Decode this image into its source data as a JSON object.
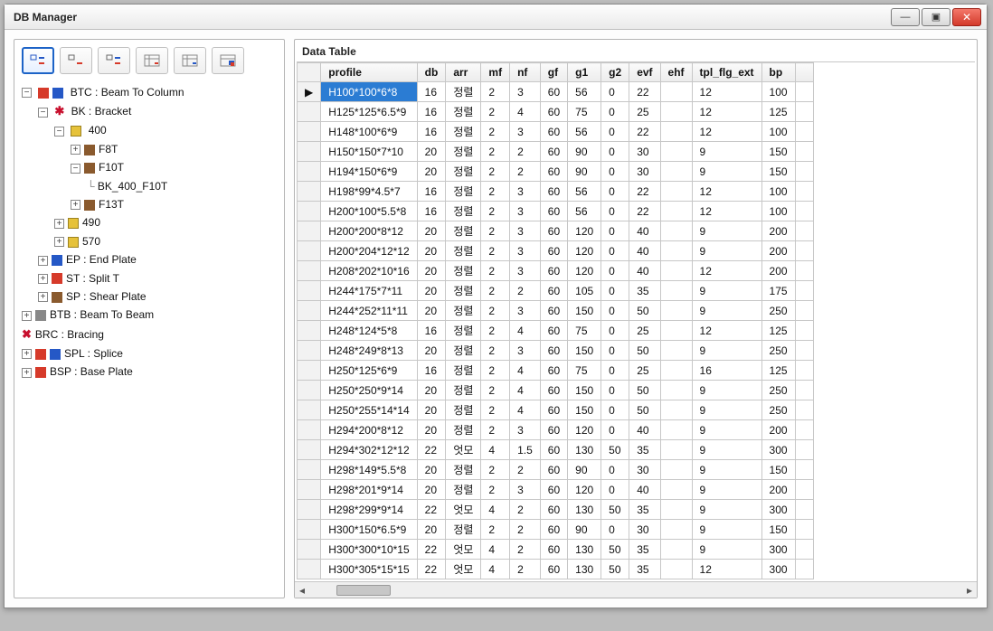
{
  "window": {
    "title": "DB Manager"
  },
  "panel": {
    "data_table_title": "Data Table"
  },
  "tree": {
    "btc": {
      "label": "BTC : Beam To Column"
    },
    "bk": {
      "label": "BK : Bracket"
    },
    "n400": {
      "label": "400"
    },
    "f8t": {
      "label": "F8T"
    },
    "f10t": {
      "label": "F10T"
    },
    "bk400f10t": {
      "label": "BK_400_F10T"
    },
    "f13t": {
      "label": "F13T"
    },
    "n490": {
      "label": "490"
    },
    "n570": {
      "label": "570"
    },
    "ep": {
      "label": "EP : End Plate"
    },
    "st": {
      "label": "ST : Split T"
    },
    "sp": {
      "label": "SP : Shear Plate"
    },
    "btb": {
      "label": "BTB : Beam To Beam"
    },
    "brc": {
      "label": "BRC : Bracing"
    },
    "spl": {
      "label": "SPL : Splice"
    },
    "bsp": {
      "label": "BSP : Base Plate"
    }
  },
  "columns": [
    "profile",
    "db",
    "arr",
    "mf",
    "nf",
    "gf",
    "g1",
    "g2",
    "evf",
    "ehf",
    "tpl_flg_ext",
    "bp"
  ],
  "rows": [
    {
      "profile": "H100*100*6*8",
      "db": "16",
      "arr": "정렬",
      "mf": "2",
      "nf": "3",
      "gf": "60",
      "g1": "56",
      "g2": "0",
      "evf": "22",
      "ehf": "",
      "tpl_flg_ext": "12",
      "bp": "100"
    },
    {
      "profile": "H125*125*6.5*9",
      "db": "16",
      "arr": "정렬",
      "mf": "2",
      "nf": "4",
      "gf": "60",
      "g1": "75",
      "g2": "0",
      "evf": "25",
      "ehf": "",
      "tpl_flg_ext": "12",
      "bp": "125"
    },
    {
      "profile": "H148*100*6*9",
      "db": "16",
      "arr": "정렬",
      "mf": "2",
      "nf": "3",
      "gf": "60",
      "g1": "56",
      "g2": "0",
      "evf": "22",
      "ehf": "",
      "tpl_flg_ext": "12",
      "bp": "100"
    },
    {
      "profile": "H150*150*7*10",
      "db": "20",
      "arr": "정렬",
      "mf": "2",
      "nf": "2",
      "gf": "60",
      "g1": "90",
      "g2": "0",
      "evf": "30",
      "ehf": "",
      "tpl_flg_ext": "9",
      "bp": "150"
    },
    {
      "profile": "H194*150*6*9",
      "db": "20",
      "arr": "정렬",
      "mf": "2",
      "nf": "2",
      "gf": "60",
      "g1": "90",
      "g2": "0",
      "evf": "30",
      "ehf": "",
      "tpl_flg_ext": "9",
      "bp": "150"
    },
    {
      "profile": "H198*99*4.5*7",
      "db": "16",
      "arr": "정렬",
      "mf": "2",
      "nf": "3",
      "gf": "60",
      "g1": "56",
      "g2": "0",
      "evf": "22",
      "ehf": "",
      "tpl_flg_ext": "12",
      "bp": "100"
    },
    {
      "profile": "H200*100*5.5*8",
      "db": "16",
      "arr": "정렬",
      "mf": "2",
      "nf": "3",
      "gf": "60",
      "g1": "56",
      "g2": "0",
      "evf": "22",
      "ehf": "",
      "tpl_flg_ext": "12",
      "bp": "100"
    },
    {
      "profile": "H200*200*8*12",
      "db": "20",
      "arr": "정렬",
      "mf": "2",
      "nf": "3",
      "gf": "60",
      "g1": "120",
      "g2": "0",
      "evf": "40",
      "ehf": "",
      "tpl_flg_ext": "9",
      "bp": "200"
    },
    {
      "profile": "H200*204*12*12",
      "db": "20",
      "arr": "정렬",
      "mf": "2",
      "nf": "3",
      "gf": "60",
      "g1": "120",
      "g2": "0",
      "evf": "40",
      "ehf": "",
      "tpl_flg_ext": "9",
      "bp": "200"
    },
    {
      "profile": "H208*202*10*16",
      "db": "20",
      "arr": "정렬",
      "mf": "2",
      "nf": "3",
      "gf": "60",
      "g1": "120",
      "g2": "0",
      "evf": "40",
      "ehf": "",
      "tpl_flg_ext": "12",
      "bp": "200"
    },
    {
      "profile": "H244*175*7*11",
      "db": "20",
      "arr": "정렬",
      "mf": "2",
      "nf": "2",
      "gf": "60",
      "g1": "105",
      "g2": "0",
      "evf": "35",
      "ehf": "",
      "tpl_flg_ext": "9",
      "bp": "175"
    },
    {
      "profile": "H244*252*11*11",
      "db": "20",
      "arr": "정렬",
      "mf": "2",
      "nf": "3",
      "gf": "60",
      "g1": "150",
      "g2": "0",
      "evf": "50",
      "ehf": "",
      "tpl_flg_ext": "9",
      "bp": "250"
    },
    {
      "profile": "H248*124*5*8",
      "db": "16",
      "arr": "정렬",
      "mf": "2",
      "nf": "4",
      "gf": "60",
      "g1": "75",
      "g2": "0",
      "evf": "25",
      "ehf": "",
      "tpl_flg_ext": "12",
      "bp": "125"
    },
    {
      "profile": "H248*249*8*13",
      "db": "20",
      "arr": "정렬",
      "mf": "2",
      "nf": "3",
      "gf": "60",
      "g1": "150",
      "g2": "0",
      "evf": "50",
      "ehf": "",
      "tpl_flg_ext": "9",
      "bp": "250"
    },
    {
      "profile": "H250*125*6*9",
      "db": "16",
      "arr": "정렬",
      "mf": "2",
      "nf": "4",
      "gf": "60",
      "g1": "75",
      "g2": "0",
      "evf": "25",
      "ehf": "",
      "tpl_flg_ext": "16",
      "bp": "125"
    },
    {
      "profile": "H250*250*9*14",
      "db": "20",
      "arr": "정렬",
      "mf": "2",
      "nf": "4",
      "gf": "60",
      "g1": "150",
      "g2": "0",
      "evf": "50",
      "ehf": "",
      "tpl_flg_ext": "9",
      "bp": "250"
    },
    {
      "profile": "H250*255*14*14",
      "db": "20",
      "arr": "정렬",
      "mf": "2",
      "nf": "4",
      "gf": "60",
      "g1": "150",
      "g2": "0",
      "evf": "50",
      "ehf": "",
      "tpl_flg_ext": "9",
      "bp": "250"
    },
    {
      "profile": "H294*200*8*12",
      "db": "20",
      "arr": "정렬",
      "mf": "2",
      "nf": "3",
      "gf": "60",
      "g1": "120",
      "g2": "0",
      "evf": "40",
      "ehf": "",
      "tpl_flg_ext": "9",
      "bp": "200"
    },
    {
      "profile": "H294*302*12*12",
      "db": "22",
      "arr": "엇모",
      "mf": "4",
      "nf": "1.5",
      "gf": "60",
      "g1": "130",
      "g2": "50",
      "evf": "35",
      "ehf": "",
      "tpl_flg_ext": "9",
      "bp": "300"
    },
    {
      "profile": "H298*149*5.5*8",
      "db": "20",
      "arr": "정렬",
      "mf": "2",
      "nf": "2",
      "gf": "60",
      "g1": "90",
      "g2": "0",
      "evf": "30",
      "ehf": "",
      "tpl_flg_ext": "9",
      "bp": "150"
    },
    {
      "profile": "H298*201*9*14",
      "db": "20",
      "arr": "정렬",
      "mf": "2",
      "nf": "3",
      "gf": "60",
      "g1": "120",
      "g2": "0",
      "evf": "40",
      "ehf": "",
      "tpl_flg_ext": "9",
      "bp": "200"
    },
    {
      "profile": "H298*299*9*14",
      "db": "22",
      "arr": "엇모",
      "mf": "4",
      "nf": "2",
      "gf": "60",
      "g1": "130",
      "g2": "50",
      "evf": "35",
      "ehf": "",
      "tpl_flg_ext": "9",
      "bp": "300"
    },
    {
      "profile": "H300*150*6.5*9",
      "db": "20",
      "arr": "정렬",
      "mf": "2",
      "nf": "2",
      "gf": "60",
      "g1": "90",
      "g2": "0",
      "evf": "30",
      "ehf": "",
      "tpl_flg_ext": "9",
      "bp": "150"
    },
    {
      "profile": "H300*300*10*15",
      "db": "22",
      "arr": "엇모",
      "mf": "4",
      "nf": "2",
      "gf": "60",
      "g1": "130",
      "g2": "50",
      "evf": "35",
      "ehf": "",
      "tpl_flg_ext": "9",
      "bp": "300"
    },
    {
      "profile": "H300*305*15*15",
      "db": "22",
      "arr": "엇모",
      "mf": "4",
      "nf": "2",
      "gf": "60",
      "g1": "130",
      "g2": "50",
      "evf": "35",
      "ehf": "",
      "tpl_flg_ext": "12",
      "bp": "300"
    }
  ]
}
